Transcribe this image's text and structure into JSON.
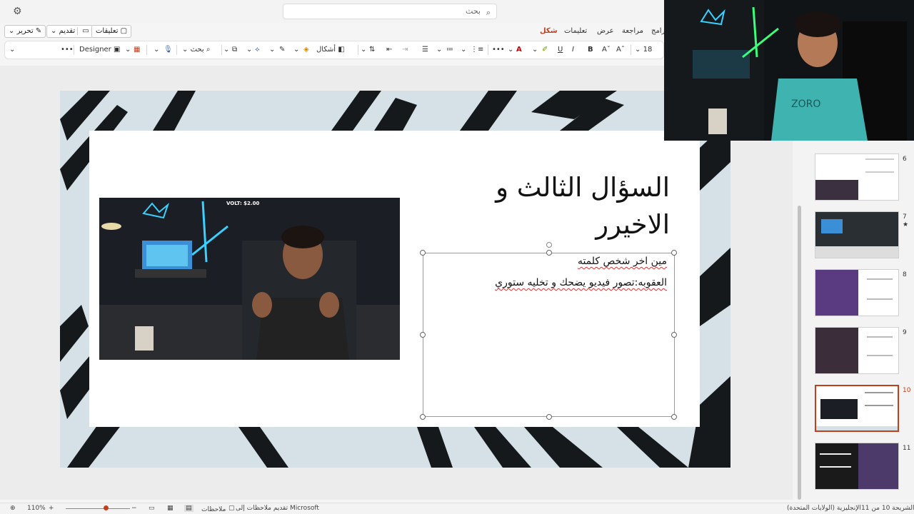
{
  "topbar": {
    "search_placeholder": "بحث",
    "settings_icon": "gear-icon"
  },
  "actions": {
    "edit_label": "تحرير",
    "present_label": "تقديم",
    "comments_label": "تعليقات"
  },
  "tabs": [
    "شكل",
    "تعليمات",
    "عرض",
    "مراجعة",
    "برامج"
  ],
  "active_tab": "شكل",
  "ribbon": {
    "designer_label": "Designer",
    "search_label": "بحث",
    "shapes_label": "أشكال",
    "font_size": "18"
  },
  "slide": {
    "title_line1": "السؤال الثالث و",
    "title_line2": "الاخيرر",
    "body_line1": "مين اخر شخص كلمته",
    "body_line2": "العقوبه:تصور فيديو يضحك و تخليه ستوري",
    "photo_caption": "VOLT: $2.00"
  },
  "thumbnails": [
    {
      "number": "6",
      "selected": false
    },
    {
      "number": "7",
      "selected": false,
      "star": "★"
    },
    {
      "number": "8",
      "selected": false
    },
    {
      "number": "9",
      "selected": false
    },
    {
      "number": "10",
      "selected": true
    },
    {
      "number": "11",
      "selected": false
    }
  ],
  "status": {
    "slide_info": "الشريحة 10 من 11",
    "language": "الإنجليزية (الولايات المتحدة)",
    "feedback": "تقديم ملاحظات إلى Microsoft",
    "notes_label": "ملاحظات",
    "zoom": "110%"
  },
  "colors": {
    "accent": "#c43e1c",
    "slide_bg": "#d5e1e7"
  }
}
